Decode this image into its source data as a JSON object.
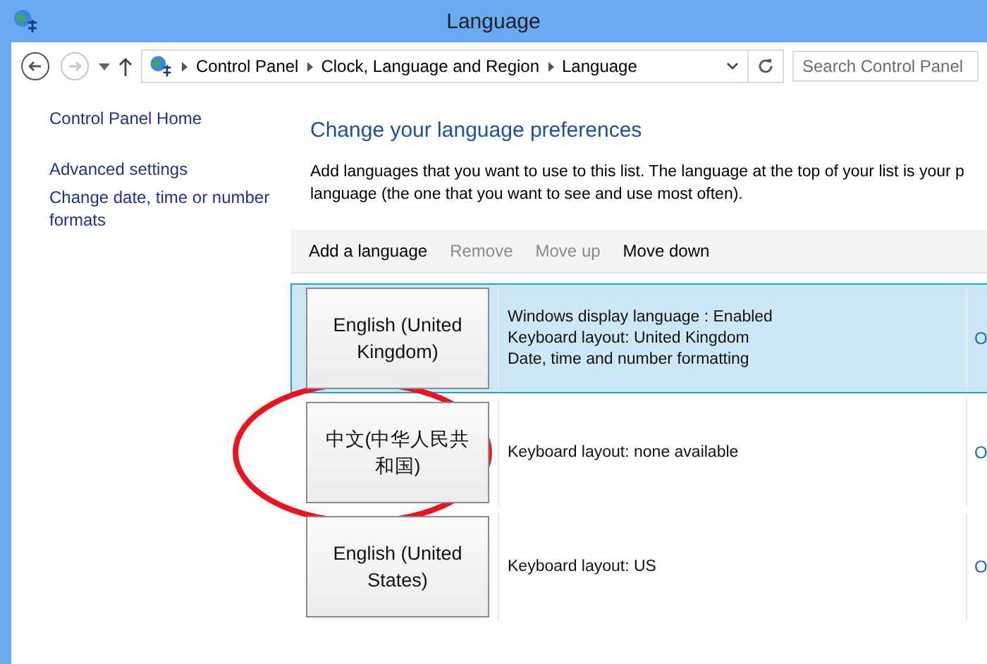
{
  "window": {
    "title": "Language"
  },
  "address_bar": {
    "breadcrumbs": [
      "Control Panel",
      "Clock, Language and Region",
      "Language"
    ],
    "search": {
      "placeholder": "Search Control Panel"
    },
    "forward_disabled": true
  },
  "sidebar": {
    "items": [
      "Control Panel Home",
      "Advanced settings",
      "Change date, time or number formats"
    ]
  },
  "content": {
    "heading": "Change your language preferences",
    "intro": [
      "Add languages that you want to use to this list. The language at the top of your list is your p",
      "language (the one that you want to see and use most often)."
    ]
  },
  "toolbar": [
    {
      "label": "Add a language",
      "disabled": false
    },
    {
      "label": "Remove",
      "disabled": true
    },
    {
      "label": "Move up",
      "disabled": true
    },
    {
      "label": "Move down",
      "disabled": false
    }
  ],
  "languages": [
    {
      "name": "English (United Kingdom)",
      "details": [
        "Windows display language : Enabled",
        "Keyboard layout: United Kingdom",
        "Date, time and number formatting"
      ],
      "options": "O",
      "selected": true
    },
    {
      "name": "中文(中华人民共和国)",
      "details": [
        "Keyboard layout: none available"
      ],
      "options": "O",
      "selected": false
    },
    {
      "name": "English (United States)",
      "details": [
        "Keyboard layout: US"
      ],
      "options": "O",
      "selected": false
    }
  ]
}
